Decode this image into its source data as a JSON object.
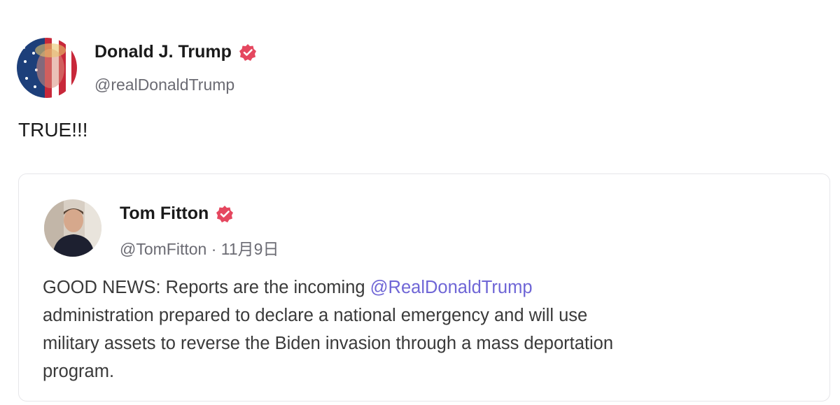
{
  "post": {
    "author_name": "Donald J. Trump",
    "author_handle": "@realDonaldTrump",
    "text": "TRUE!!!",
    "verified_icon": "verified-badge-icon",
    "accent_color": "#e5475f"
  },
  "quote": {
    "author_name": "Tom Fitton",
    "author_handle": "@TomFitton",
    "separator": " · ",
    "date": "11月9日",
    "body_prefix": "GOOD NEWS: Reports are the incoming ",
    "mention": "@RealDonaldTrump",
    "body_line_2": " administration prepared to declare a national emergency and will use",
    "body_line_3": "military assets to reverse the Biden invasion through a mass deportation",
    "body_line_4": "program.",
    "mention_color": "#6f66d6"
  }
}
